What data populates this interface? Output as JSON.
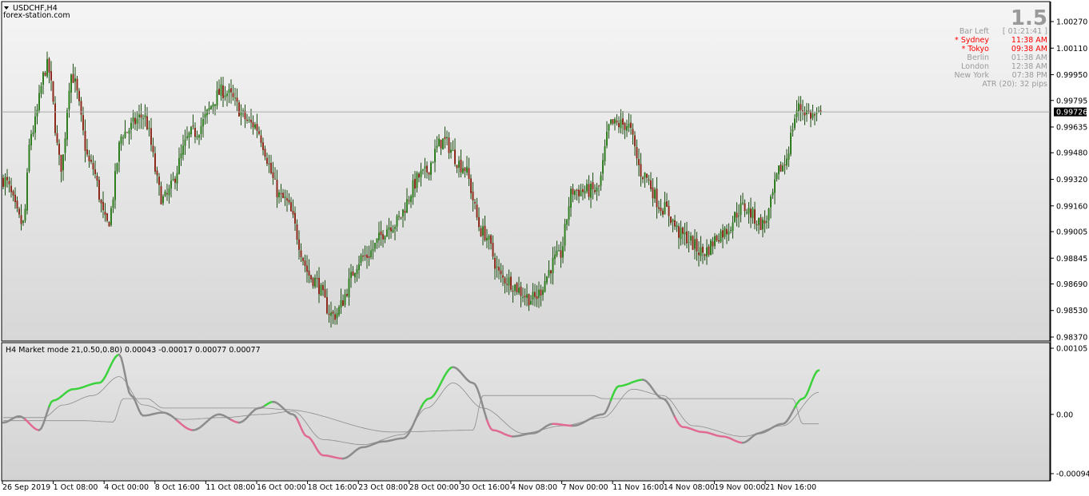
{
  "window": {
    "symbol_label": "USDCHF,H4",
    "source_label": "forex-station.com",
    "menu_icon": "triangle-down-icon"
  },
  "info_panel": {
    "big_value": "1.5",
    "rows": [
      {
        "label": "Bar Left",
        "value": "[ 01:21:41 ]",
        "color": "#9a9a9a"
      },
      {
        "label": "* Sydney",
        "value": "11:38 AM",
        "color": "#ff0000"
      },
      {
        "label": "* Tokyo",
        "value": "09:38 AM",
        "color": "#ff0000"
      },
      {
        "label": "Berlin",
        "value": "01:38 AM",
        "color": "#9a9a9a"
      },
      {
        "label": "London",
        "value": "12:38 AM",
        "color": "#9a9a9a"
      },
      {
        "label": "New York",
        "value": "07:38 PM",
        "color": "#9a9a9a"
      }
    ],
    "atr_text": "ATR (20): 32 pips"
  },
  "indicator": {
    "label": "H4 Market mode 21,0.50,0.80) 0.00043 -0.00017 0.00077 0.00077"
  },
  "colors": {
    "bull_body": "#2e7d1e",
    "bear_body": "#8b2a1a",
    "wick": "#1a4d10",
    "up_line": "#3cd23c",
    "down_line": "#e06a90",
    "neutral_line": "#8c8c8c",
    "price_line": "#aaaaaa",
    "price_tag_bg": "#000000"
  },
  "chart_data": [
    {
      "type": "candlestick",
      "title": "USDCHF,H4",
      "ylim": [
        0.9837,
        1.0027
      ],
      "y_ticks": [
        "1.00270",
        "1.00110",
        "0.99950",
        "0.99795",
        "0.99635",
        "0.99480",
        "0.99320",
        "0.99160",
        "0.99005",
        "0.98845",
        "0.98690",
        "0.98530",
        "0.98370"
      ],
      "current_price": "0.99726",
      "x_ticks": [
        "26 Sep 2019",
        "1 Oct 08:00",
        "4 Oct 00:00",
        "8 Oct 16:00",
        "11 Oct 08:00",
        "16 Oct 00:00",
        "18 Oct 16:00",
        "23 Oct 08:00",
        "28 Oct 00:00",
        "30 Oct 16:00",
        "4 Nov 08:00",
        "7 Nov 00:00",
        "11 Nov 16:00",
        "14 Nov 08:00",
        "19 Nov 00:00",
        "21 Nov 16:00"
      ],
      "path_keypoints": [
        [
          0,
          0.9932
        ],
        [
          10,
          0.9905
        ],
        [
          14,
          0.996
        ],
        [
          22,
          1.0
        ],
        [
          29,
          0.994
        ],
        [
          34,
          0.9995
        ],
        [
          44,
          0.994
        ],
        [
          52,
          0.9905
        ],
        [
          60,
          0.996
        ],
        [
          70,
          0.997
        ],
        [
          80,
          0.992
        ],
        [
          95,
          0.996
        ],
        [
          110,
          0.9985
        ],
        [
          125,
          0.9965
        ],
        [
          140,
          0.992
        ],
        [
          155,
          0.9872
        ],
        [
          165,
          0.985
        ],
        [
          180,
          0.9885
        ],
        [
          195,
          0.9905
        ],
        [
          210,
          0.9935
        ],
        [
          220,
          0.9955
        ],
        [
          230,
          0.994
        ],
        [
          240,
          0.99
        ],
        [
          250,
          0.9872
        ],
        [
          265,
          0.986
        ],
        [
          278,
          0.9885
        ],
        [
          285,
          0.9925
        ],
        [
          297,
          0.9925
        ],
        [
          304,
          0.9965
        ],
        [
          312,
          0.9965
        ],
        [
          320,
          0.9935
        ],
        [
          330,
          0.9915
        ],
        [
          340,
          0.9898
        ],
        [
          350,
          0.9888
        ],
        [
          360,
          0.99
        ],
        [
          370,
          0.9915
        ],
        [
          380,
          0.9905
        ],
        [
          390,
          0.994
        ],
        [
          398,
          0.9975
        ],
        [
          406,
          0.997
        ],
        [
          410,
          0.997
        ]
      ]
    },
    {
      "type": "line",
      "title": "H4 Market mode 21,0.50,0.80) 0.00043 -0.00017 0.00077 0.00077",
      "ylim": [
        -0.00094,
        0.00105
      ],
      "y_ticks": [
        "0.00105",
        "0.00",
        "-0.00094"
      ],
      "series": [
        {
          "role": "main",
          "keypoints": [
            [
              0,
              -0.00013
            ],
            [
              8,
              -3e-05
            ],
            [
              18,
              -0.00025
            ],
            [
              25,
              0.00022
            ],
            [
              35,
              0.0004
            ],
            [
              48,
              0.0005
            ],
            [
              58,
              0.00095
            ],
            [
              64,
              0.0003
            ],
            [
              70,
              -2e-05
            ],
            [
              80,
              3e-05
            ],
            [
              95,
              -0.00025
            ],
            [
              108,
              0.0
            ],
            [
              118,
              -0.00013
            ],
            [
              128,
              0.0001
            ],
            [
              135,
              0.0002
            ],
            [
              145,
              0.0
            ],
            [
              152,
              -0.00035
            ],
            [
              160,
              -0.00065
            ],
            [
              170,
              -0.0007
            ],
            [
              180,
              -0.00052
            ],
            [
              190,
              -0.00043
            ],
            [
              200,
              -0.00038
            ],
            [
              213,
              0.00025
            ],
            [
              225,
              0.00075
            ],
            [
              235,
              0.0005
            ],
            [
              245,
              -0.00025
            ],
            [
              255,
              -0.00035
            ],
            [
              265,
              -0.0003
            ],
            [
              275,
              -0.00015
            ],
            [
              285,
              -0.00018
            ],
            [
              300,
              0.0
            ],
            [
              308,
              0.00045
            ],
            [
              320,
              0.00055
            ],
            [
              330,
              0.00025
            ],
            [
              340,
              -0.0002
            ],
            [
              350,
              -0.00028
            ],
            [
              360,
              -0.00035
            ],
            [
              370,
              -0.00045
            ],
            [
              378,
              -0.0003
            ],
            [
              390,
              -0.00015
            ],
            [
              400,
              0.00025
            ],
            [
              408,
              0.0007
            ]
          ]
        },
        {
          "role": "smoothed",
          "keypoints": [
            [
              0,
              -5e-05
            ],
            [
              20,
              -5e-05
            ],
            [
              30,
              0.00015
            ],
            [
              45,
              0.0003
            ],
            [
              58,
              0.0006
            ],
            [
              70,
              0.00015
            ],
            [
              90,
              -8e-05
            ],
            [
              110,
              -5e-05
            ],
            [
              130,
              0.0
            ],
            [
              145,
              5e-05
            ],
            [
              160,
              -0.0004
            ],
            [
              180,
              -0.00048
            ],
            [
              200,
              -0.00032
            ],
            [
              212,
              0.0001
            ],
            [
              225,
              0.0005
            ],
            [
              240,
              0.0001
            ],
            [
              260,
              -0.0003
            ],
            [
              280,
              -0.00018
            ],
            [
              300,
              -5e-05
            ],
            [
              315,
              0.0004
            ],
            [
              330,
              0.0003
            ],
            [
              345,
              -0.00018
            ],
            [
              370,
              -0.00035
            ],
            [
              390,
              -0.00018
            ],
            [
              408,
              0.00035
            ]
          ]
        },
        {
          "role": "level",
          "keypoints": [
            [
              0,
              -0.0001
            ],
            [
              40,
              -0.0001
            ],
            [
              55,
              -0.00012
            ],
            [
              60,
              0.00025
            ],
            [
              72,
              0.00025
            ],
            [
              80,
              0.0001
            ],
            [
              130,
              0.0001
            ],
            [
              140,
              8e-05
            ],
            [
              195,
              -0.00028
            ],
            [
              235,
              -0.00025
            ],
            [
              240,
              0.0003
            ],
            [
              295,
              0.0003
            ],
            [
              300,
              0.00025
            ],
            [
              330,
              0.00025
            ],
            [
              335,
              0.00025
            ],
            [
              395,
              0.00025
            ],
            [
              400,
              -0.00015
            ],
            [
              408,
              -0.00015
            ]
          ]
        }
      ]
    }
  ]
}
